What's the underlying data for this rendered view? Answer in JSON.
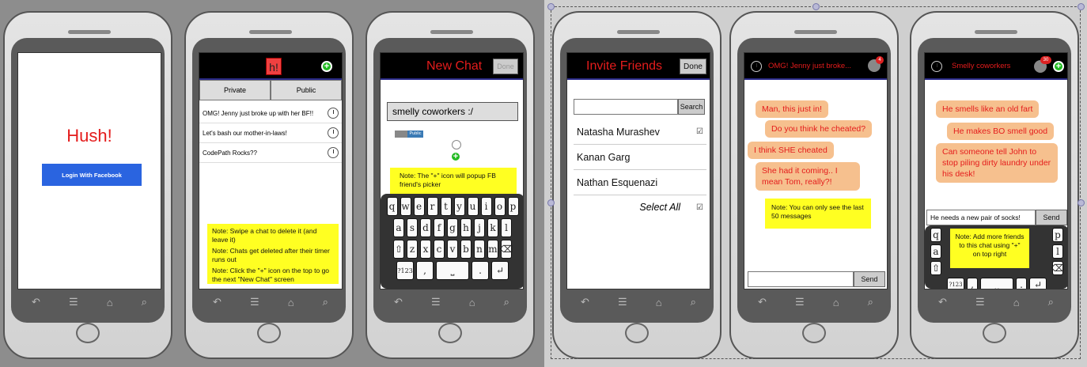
{
  "screens": {
    "login": {
      "title": "Hush!",
      "fb_button": "Login With Facebook",
      "button_color": "#2a64e0"
    },
    "chat_list": {
      "logo": "h!",
      "tab_private": "Private",
      "tab_public": "Public",
      "chats": [
        "OMG! Jenny just broke up with her BF!!",
        "Let's bash our mother-in-laws!",
        "CodePath Rocks??"
      ],
      "note1": "Note: Swipe a chat to delete it (and leave it)",
      "note2": "Note: Chats get deleted after their timer runs out",
      "note3": "Note: Click the \"+\" icon on the top to go the next \"New Chat\" screen"
    },
    "new_chat": {
      "title": "New Chat",
      "done": "Done",
      "name_value": "smelly coworkers :/",
      "toggle_label": "Public",
      "note": "Note: The \"+\" icon will popup FB friend's picker",
      "keys_row1": [
        "q",
        "w",
        "e",
        "r",
        "t",
        "y",
        "u",
        "i",
        "o",
        "p"
      ],
      "keys_row2": [
        "a",
        "s",
        "d",
        "f",
        "g",
        "h",
        "j",
        "k",
        "l"
      ],
      "keys_row3": [
        "z",
        "x",
        "c",
        "v",
        "b",
        "n",
        "m"
      ],
      "key_123": "?123",
      "key_comma": ",",
      "key_period": "."
    },
    "invite": {
      "title": "Invite Friends",
      "done": "Done",
      "search_button": "Search",
      "friends": [
        "Natasha Murashev",
        "Kanan Garg",
        "Nathan Esquenazi"
      ],
      "select_all": "Select All"
    },
    "chat1": {
      "title": "OMG! Jenny just broke...",
      "badge": "4",
      "messages": [
        "Man, this just in!",
        "Do you think he cheated?",
        "I think SHE cheated",
        "She had it coming.. I mean Tom, really?!"
      ],
      "note": "Note: You can only see the last 50 messages",
      "send": "Send"
    },
    "chat2": {
      "title": "Smelly coworkers",
      "badge": "30",
      "messages": [
        "He smells like an old fart",
        "He makes BO smell good",
        "Can someone tell John to stop piling dirty laundry under his desk!"
      ],
      "input_value": "He needs a new pair of socks!",
      "send": "Send",
      "note": "Note: Add more friends to this chat using \"+\" on top right"
    }
  },
  "icons": {
    "back": "back-icon",
    "menu": "menu-icon",
    "home": "home-icon",
    "search": "search-icon"
  }
}
